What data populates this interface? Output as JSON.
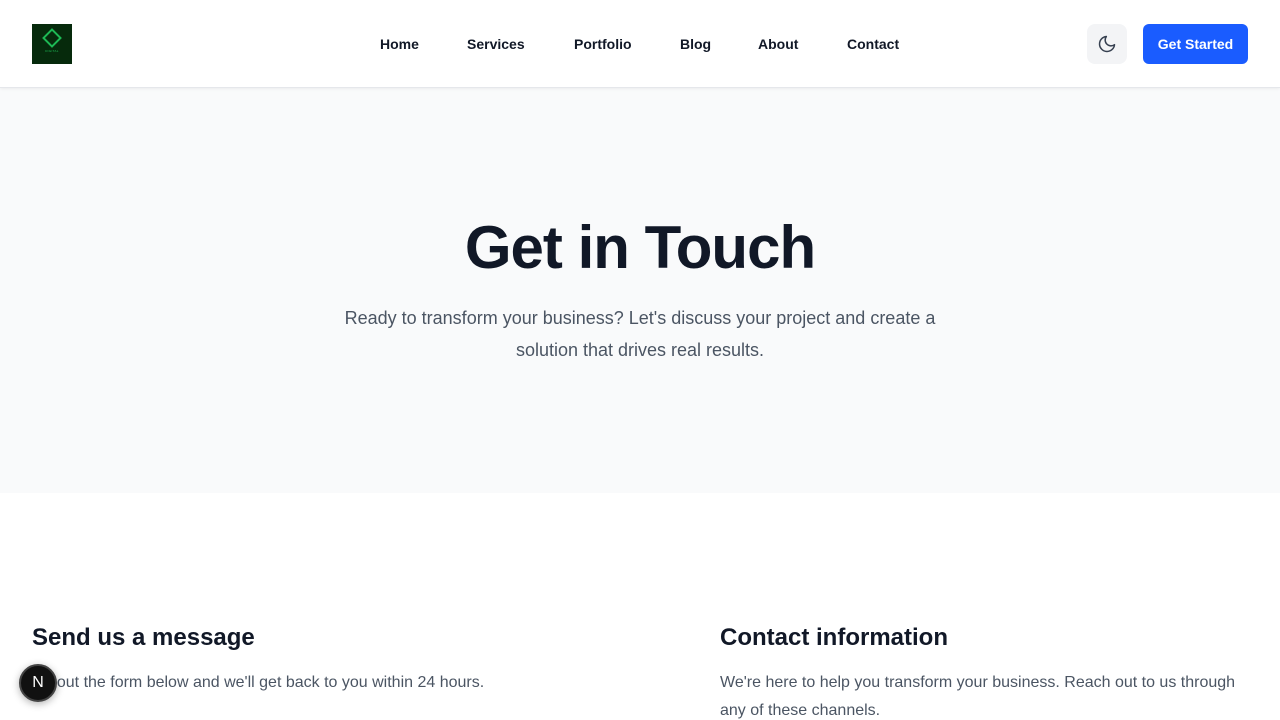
{
  "header": {
    "logo_text": "DIGITAL",
    "nav": [
      {
        "label": "Home"
      },
      {
        "label": "Services"
      },
      {
        "label": "Portfolio"
      },
      {
        "label": "Blog"
      },
      {
        "label": "About"
      },
      {
        "label": "Contact"
      }
    ],
    "theme_toggle_icon": "moon-icon",
    "cta_label": "Get Started",
    "accent_color": "#1a5cff"
  },
  "hero": {
    "title": "Get in Touch",
    "subtitle": "Ready to transform your business? Let's discuss your project and create a solution that drives real results."
  },
  "message_section": {
    "title": "Send us a message",
    "description": "Fill out the form below and we'll get back to you within 24 hours."
  },
  "contact_section": {
    "title": "Contact information",
    "description": "We're here to help you transform your business. Reach out to us through any of these channels."
  },
  "dev_badge": {
    "label": "N"
  }
}
